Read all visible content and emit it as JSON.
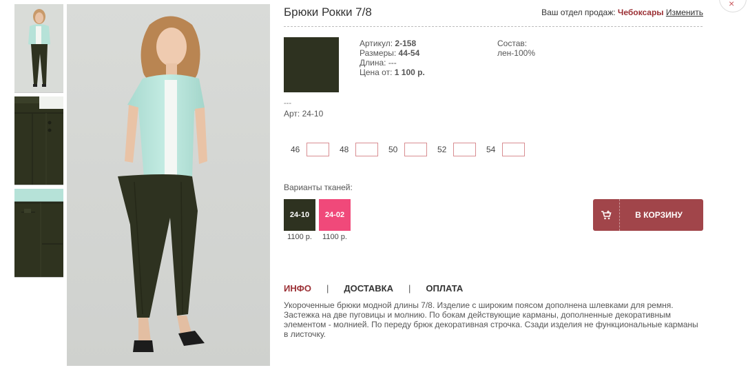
{
  "product": {
    "title": "Брюки Рокки 7/8",
    "swatch_color": "#2e3220",
    "specs": {
      "article_label": "Артикул:",
      "article_value": "2-158",
      "sizes_label": "Размеры:",
      "sizes_value": "44-54",
      "length_label": "Длина:",
      "length_value": "---",
      "price_label": "Цена от:",
      "price_value": "1 100 р."
    },
    "composition_label": "Состав:",
    "composition_value": "лен-100%",
    "dashes": "---",
    "art_line": "Арт: 24-10"
  },
  "region": {
    "label": "Ваш отдел продаж:",
    "city": "Чебоксары",
    "change": "Изменить"
  },
  "sizes": [
    {
      "label": "46",
      "value": ""
    },
    {
      "label": "48",
      "value": ""
    },
    {
      "label": "50",
      "value": ""
    },
    {
      "label": "52",
      "value": ""
    },
    {
      "label": "54",
      "value": ""
    }
  ],
  "variants": {
    "label": "Варианты тканей:",
    "items": [
      {
        "code": "24-10",
        "price": "1100 р.",
        "color": "#2e3220"
      },
      {
        "code": "24-02",
        "price": "1100 р.",
        "color": "#f0497a"
      }
    ]
  },
  "cart": {
    "label": "В КОРЗИНУ",
    "icon": "cart-plus-icon",
    "color": "#a1454a"
  },
  "tabs": {
    "info": "ИНФО",
    "delivery": "ДОСТАВКА",
    "payment": "ОПЛАТА",
    "separator": "|",
    "accent": "#9b2f34"
  },
  "description": "Укороченные брюки модной длины 7/8. Изделие с широким поясом дополнена шлевками для ремня. Застежка на две пуговицы и молнию. По бокам действующие карманы, дополненные декоративным элементом - молнией. По переду брюк декоративная строчка. Сзади изделия не функциональные карманы в листочку.",
  "close": {
    "icon": "close-icon",
    "glyph": "×"
  }
}
